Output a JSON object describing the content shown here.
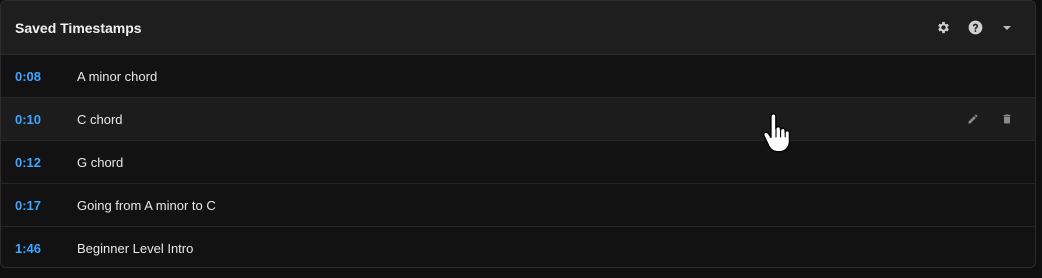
{
  "panel": {
    "title": "Saved Timestamps",
    "header_icons": [
      "gear-icon",
      "help-icon",
      "chevron-down-icon"
    ]
  },
  "timestamps": [
    {
      "time": "0:08",
      "label": "A minor chord"
    },
    {
      "time": "0:10",
      "label": "C chord"
    },
    {
      "time": "0:12",
      "label": "G chord"
    },
    {
      "time": "0:17",
      "label": "Going from A minor to C"
    },
    {
      "time": "1:46",
      "label": "Beginner Level Intro"
    }
  ],
  "row_actions": [
    "pencil-icon",
    "trash-icon"
  ],
  "colors": {
    "accent": "#3ea6ff",
    "header_bg": "#1e1e1e",
    "row_bg": "#121212",
    "row_hover_bg": "#1c1c1c"
  }
}
